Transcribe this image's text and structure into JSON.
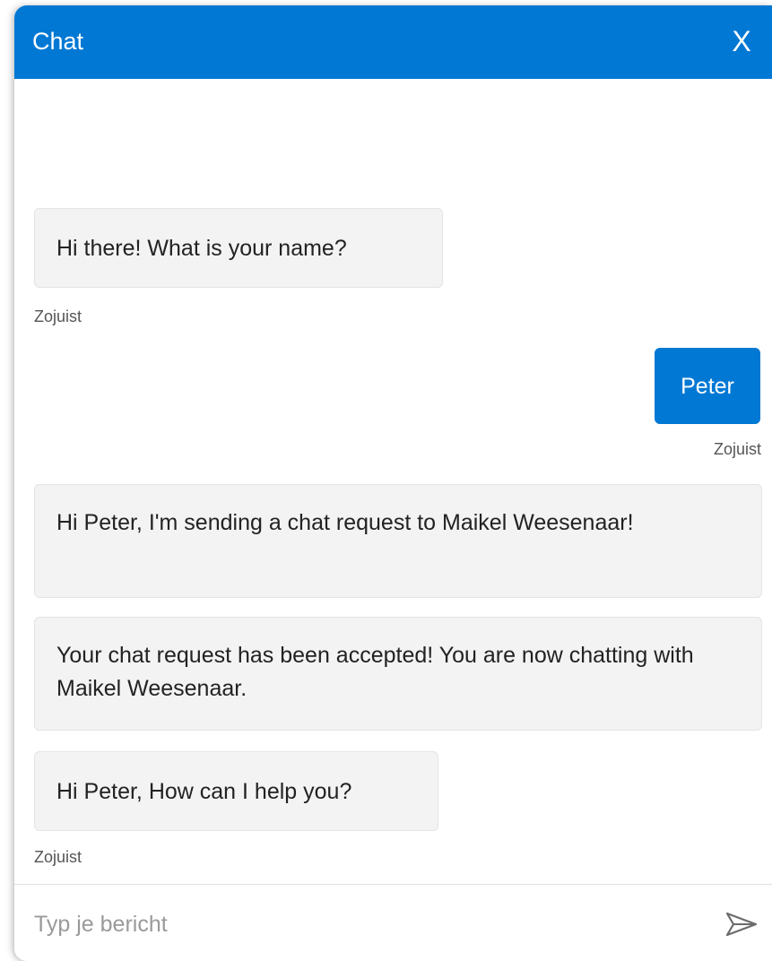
{
  "header": {
    "title": "Chat",
    "close_label": "X",
    "color": "#0078d4"
  },
  "messages": [
    {
      "sender": "bot",
      "text": "Hi there! What is your name?"
    },
    {
      "sender": "bot",
      "timestamp": "Zojuist"
    },
    {
      "sender": "user",
      "text": "Peter",
      "timestamp": "Zojuist"
    },
    {
      "sender": "bot",
      "text": "Hi Peter, I'm sending a chat request to Maikel Weesenaar!"
    },
    {
      "sender": "bot",
      "text": "Your chat request has been accepted! You are now chatting with Maikel Weesenaar."
    },
    {
      "sender": "bot",
      "text": "Hi Peter, How can I help you?",
      "timestamp": "Zojuist"
    }
  ],
  "composer": {
    "placeholder": "Typ je bericht",
    "value": "",
    "send_icon": "send-icon"
  }
}
